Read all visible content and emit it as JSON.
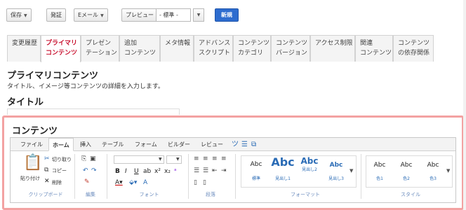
{
  "toolbar": {
    "save": "保存",
    "publish": "発証",
    "email": "Eメール",
    "preview": "プレビュー",
    "preview_select": "- 標準 -",
    "new": "新規"
  },
  "tabs": [
    {
      "line1": "変更履歴",
      "line2": ""
    },
    {
      "line1": "プライマリ",
      "line2": "コンテンツ"
    },
    {
      "line1": "プレゼン",
      "line2": "テーション"
    },
    {
      "line1": "追加",
      "line2": "コンテンツ"
    },
    {
      "line1": "メタ情報",
      "line2": ""
    },
    {
      "line1": "アドバンス",
      "line2": "スクリプト"
    },
    {
      "line1": "コンテンツ",
      "line2": "カテゴリ"
    },
    {
      "line1": "コンテンツ",
      "line2": "バージョン"
    },
    {
      "line1": "アクセス制限",
      "line2": ""
    },
    {
      "line1": "関連",
      "line2": "コンテンツ"
    },
    {
      "line1": "コンテンツ",
      "line2": "の依存関係"
    }
  ],
  "section": {
    "heading": "プライマリコンテンツ",
    "description": "タイトル、イメージ等コンテンツの詳細を入力します。",
    "title_label": "タイトル",
    "contents_label": "コンテンツ"
  },
  "editor": {
    "menu": [
      "ファイル",
      "ホーム",
      "挿入",
      "テーブル",
      "フォーム",
      "ビルダー",
      "レビュー"
    ],
    "clipboard": {
      "paste": "貼り付け",
      "cut": "切り取り",
      "copy": "コピー",
      "delete": "削除",
      "label": "クリップボード"
    },
    "edit_label": "編集",
    "font_label": "フォント",
    "paragraph_label": "段落",
    "format": {
      "label": "フォーマット",
      "styles": [
        {
          "sample": "Abc",
          "name": "標準"
        },
        {
          "sample": "Abc",
          "name": "見出し1"
        },
        {
          "sample": "Abc",
          "name": "見出し2"
        },
        {
          "sample": "Abc",
          "name": "見出し3"
        }
      ]
    },
    "style": {
      "label": "スタイル",
      "styles": [
        {
          "sample": "Abc",
          "name": "色1"
        },
        {
          "sample": "Abc",
          "name": "色2"
        },
        {
          "sample": "Abc",
          "name": "色3"
        }
      ]
    }
  },
  "colors": {
    "accent": "#c8102e",
    "primary_button": "#2d6ccf",
    "highlight_border": "#f3a2a2",
    "heading_blue": "#2b6cb6"
  }
}
